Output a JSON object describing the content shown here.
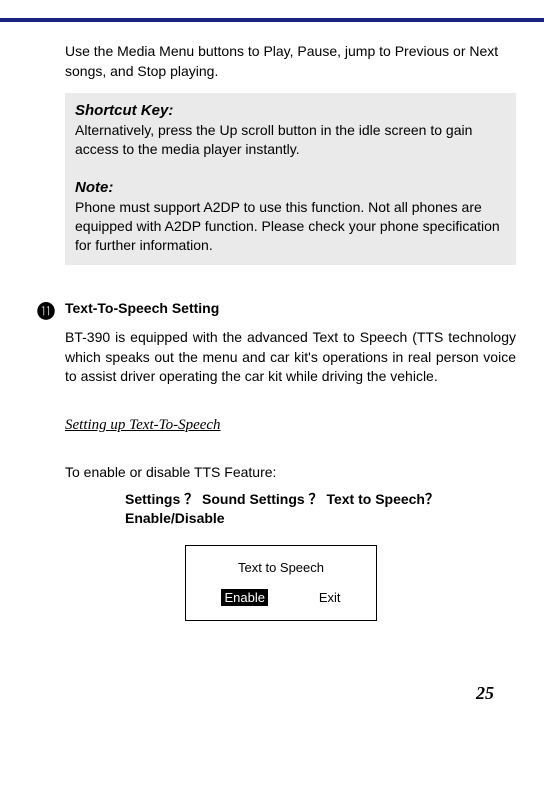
{
  "intro": "Use the Media Menu buttons to Play, Pause, jump to Previous or Next songs, and Stop playing.",
  "box": {
    "shortcut_hdr": "Shortcut Key:",
    "shortcut_body": "Alternatively, press the Up scroll button in the idle screen to gain access to the media player instantly.",
    "note_hdr": "Note:",
    "note_body": "Phone must support A2DP to use this function. Not all phones are equipped with A2DP function. Please check your phone specification for further information."
  },
  "bullet": "⓫",
  "section_title": "Text-To-Speech Setting",
  "tts_body": "BT-390 is equipped with the advanced Text to Speech (TTS technology which speaks out the menu and car kit's operations in real person voice to assist driver operating the car kit while driving the vehicle.",
  "sub_hdr": "Setting up Text-To-Speech",
  "enable_line": "To enable or disable TTS Feature:",
  "path_line": "Settings ？ Sound Settings ？ Text to Speech？ Enable/Disable",
  "screen": {
    "title": "Text to Speech",
    "left": "Enable",
    "right": "Exit"
  },
  "page_num": "25"
}
